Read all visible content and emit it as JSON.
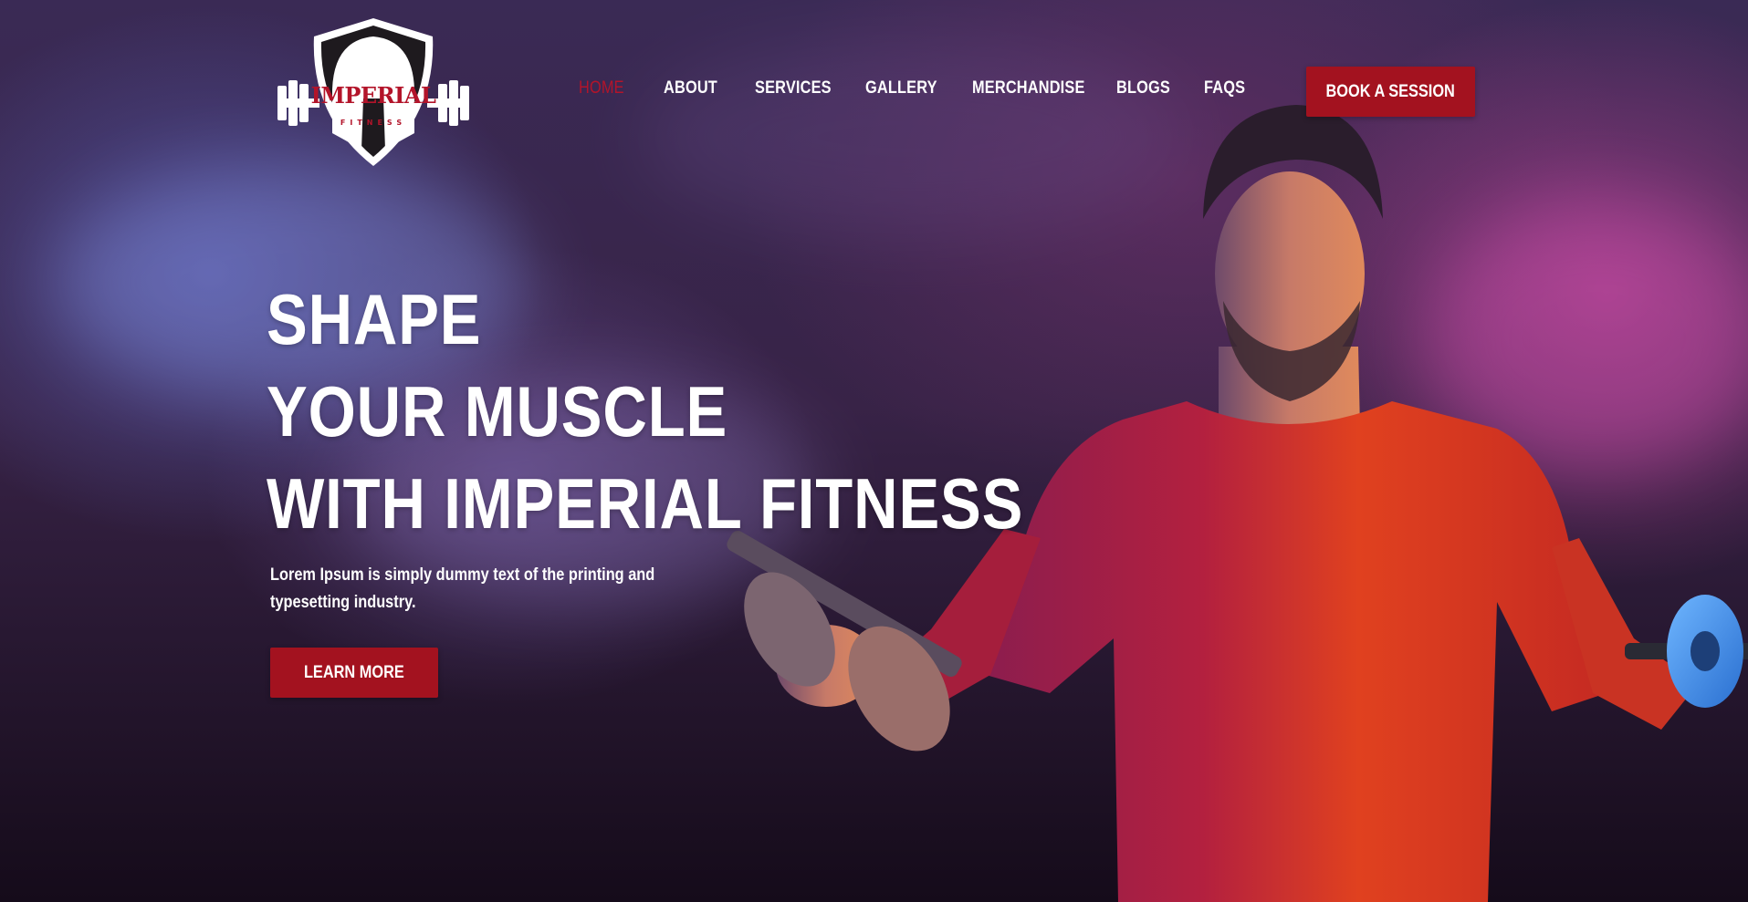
{
  "brand": {
    "name": "IMPERIAL",
    "tagline": "FITNESS"
  },
  "nav": {
    "items": [
      {
        "label": "HOME",
        "active": true
      },
      {
        "label": "ABOUT",
        "active": false
      },
      {
        "label": "SERVICES",
        "active": false
      },
      {
        "label": "GALLERY",
        "active": false
      },
      {
        "label": "MERCHANDISE",
        "active": false
      },
      {
        "label": "BLOGS",
        "active": false
      },
      {
        "label": "FAQS",
        "active": false
      }
    ],
    "cta_label": "BOOK A SESSION"
  },
  "hero": {
    "headline_lines": [
      "SHAPE",
      "YOUR MUSCLE",
      "WITH IMPERIAL FITNESS"
    ],
    "subtext": "Lorem Ipsum is simply dummy text of the printing and typesetting industry.",
    "cta_label": "LEARN MORE",
    "image_alt": "athlete-with-dumbbells-icon"
  },
  "colors": {
    "accent": "#a3121f",
    "active_nav": "#b3142a",
    "text": "#ffffff"
  }
}
